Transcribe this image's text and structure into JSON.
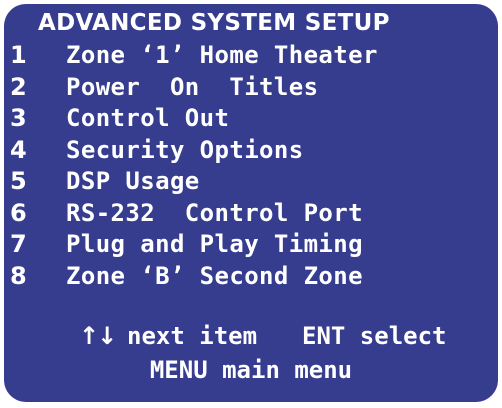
{
  "screen": {
    "title": "ADVANCED SYSTEM SETUP",
    "background_color": "#363c8e",
    "text_color": "#ffffff"
  },
  "menu": {
    "items": [
      {
        "number": "1",
        "label": "Zone ‘1’ Home Theater"
      },
      {
        "number": "2",
        "label": "Power  On  Titles"
      },
      {
        "number": "3",
        "label": "Control Out"
      },
      {
        "number": "4",
        "label": "Security Options"
      },
      {
        "number": "5",
        "label": "DSP Usage"
      },
      {
        "number": "6",
        "label": "RS-232  Control Port"
      },
      {
        "number": "7",
        "label": "Plug and Play Timing"
      },
      {
        "number": "8",
        "label": "Zone ‘B’ Second Zone"
      }
    ]
  },
  "footer": {
    "arrows_icon": "↑↓",
    "next_item_label": "next item",
    "ent_select_label": "ENT select",
    "main_menu_label": "MENU main menu"
  }
}
